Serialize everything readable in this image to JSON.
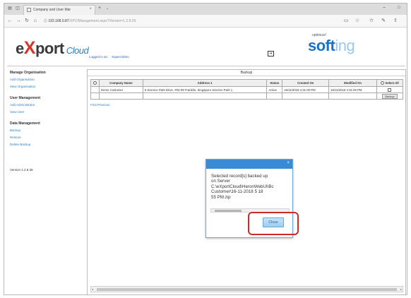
{
  "browser": {
    "tab_title": "Company and User Mar",
    "tab_close": "×",
    "new_tab": "+",
    "tab_menu": "⌄",
    "url_host": "192.168.0.87",
    "url_rest": "/XPC/Management.aspx?Version=1.2.8.39",
    "icons": [
      "back-icon",
      "forward-icon",
      "refresh-icon",
      "home-icon",
      "info-icon",
      "reading-view-icon",
      "favorite-icon",
      "favorites-icon",
      "pen-icon",
      "share-icon",
      "minimize-icon",
      "maximize-icon"
    ]
  },
  "header": {
    "logo_e": "e",
    "logo_x": "X",
    "logo_port": "port",
    "logo_cloud": "Cloud",
    "logged_in_label": "Logged in as:",
    "logged_in_user": "SuperAdmin",
    "optimize": "optimize!",
    "softing_a": "soft",
    "softing_b": "ing"
  },
  "sidebar": {
    "sections": [
      {
        "title": "Manage Organisation",
        "links": [
          "Add Organisation",
          "View Organisation"
        ]
      },
      {
        "title": "User Management",
        "links": [
          "Add Administrator",
          "View User"
        ]
      },
      {
        "title": "Data Management",
        "links": [
          "Backup",
          "Restore",
          "Delete Backup"
        ]
      }
    ],
    "version": "Version 1.2.8.39"
  },
  "panel": {
    "title": "Backup",
    "columns": [
      "Company Name",
      "Address 1",
      "Status",
      "Created On",
      "Modified On",
      "Select All"
    ],
    "rows": [
      {
        "company": "Demo Customer",
        "address": "5 Science Park Drive, #03-09 Franklin, Singapore Science Park 1",
        "status": "Active",
        "created": "16/11/2018 4:31:00 PM",
        "modified": "16/11/2018 4:31:00 PM"
      }
    ],
    "backup_button": "Backup",
    "pager": "First Previous"
  },
  "modal": {
    "message": "Selected record[s] backed up\non Server\nC:\\eXportCloud\\HeronWebUI\\Bc\nCustomer\\16-11-2018 5 18\n55 PM.zip",
    "close_label": "Close",
    "dismiss_glyph": "×"
  },
  "colors": {
    "modal_header": "#3b8ad2",
    "highlight": "#cc2b2b",
    "link": "#2d7fc3",
    "brand_red": "#d9332a",
    "softing_blue": "#1a73c8"
  }
}
